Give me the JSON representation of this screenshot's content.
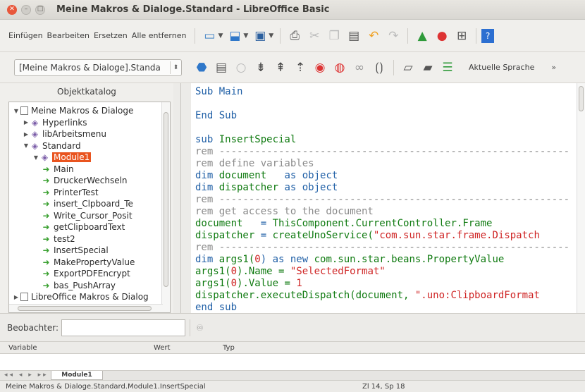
{
  "window": {
    "title": "Meine Makros & Dialoge.Standard - LibreOffice Basic"
  },
  "toolbar1": {
    "insert": "Einfügen",
    "edit": "Bearbeiten",
    "replace": "Ersetzen",
    "remove_all": "Alle entfernen"
  },
  "toolbar2": {
    "library_select": "[Meine Makros & Dialoge].Standa",
    "language": "Aktuelle Sprache",
    "overflow": "»"
  },
  "catalog": {
    "title": "Objektkatalog",
    "items": [
      {
        "label": "Meine Makros & Dialoge",
        "level": 0,
        "toggle": "▼",
        "icon": "document-icon"
      },
      {
        "label": "Hyperlinks",
        "level": 1,
        "toggle": "▶",
        "icon": "library-icon"
      },
      {
        "label": "libArbeitsmenu",
        "level": 1,
        "toggle": "▶",
        "icon": "library-icon"
      },
      {
        "label": "Standard",
        "level": 1,
        "toggle": "▼",
        "icon": "library-icon"
      },
      {
        "label": "Module1",
        "level": 2,
        "toggle": "▼",
        "icon": "module-icon",
        "selected": true
      },
      {
        "label": "Main",
        "level": 3,
        "icon": "macro-icon"
      },
      {
        "label": "DruckerWechseln",
        "level": 3,
        "icon": "macro-icon"
      },
      {
        "label": "PrinterTest",
        "level": 3,
        "icon": "macro-icon"
      },
      {
        "label": "insert_Clpboard_Te",
        "level": 3,
        "icon": "macro-icon"
      },
      {
        "label": "Write_Cursor_Posit",
        "level": 3,
        "icon": "macro-icon"
      },
      {
        "label": "getClipboardText",
        "level": 3,
        "icon": "macro-icon"
      },
      {
        "label": "test2",
        "level": 3,
        "icon": "macro-icon"
      },
      {
        "label": "InsertSpecial",
        "level": 3,
        "icon": "macro-icon"
      },
      {
        "label": "MakePropertyValue",
        "level": 3,
        "icon": "macro-icon"
      },
      {
        "label": "ExportPDFEncrypt",
        "level": 3,
        "icon": "macro-icon"
      },
      {
        "label": "bas_PushArray",
        "level": 3,
        "icon": "macro-icon"
      },
      {
        "label": "LibreOffice Makros & Dialog",
        "level": 0,
        "toggle": "▶",
        "icon": "document-icon"
      }
    ]
  },
  "code": {
    "lines": [
      [
        {
          "t": "Sub Main",
          "c": "kw"
        }
      ],
      [],
      [
        {
          "t": "End Sub",
          "c": "kw"
        }
      ],
      [],
      [
        {
          "t": "sub ",
          "c": "kw"
        },
        {
          "t": "InsertSpecial",
          "c": "id"
        }
      ],
      [
        {
          "t": "rem -----------------------------------------------------------",
          "c": "cm"
        }
      ],
      [
        {
          "t": "rem define variables",
          "c": "cm"
        }
      ],
      [
        {
          "t": "dim ",
          "c": "kw"
        },
        {
          "t": "document",
          "c": "id"
        },
        {
          "t": "   as object",
          "c": "kw"
        }
      ],
      [
        {
          "t": "dim ",
          "c": "kw"
        },
        {
          "t": "dispatcher",
          "c": "id"
        },
        {
          "t": " as object",
          "c": "kw"
        }
      ],
      [
        {
          "t": "rem -----------------------------------------------------------",
          "c": "cm"
        }
      ],
      [
        {
          "t": "rem get access to the document",
          "c": "cm"
        }
      ],
      [
        {
          "t": "document",
          "c": "id"
        },
        {
          "t": "   = ",
          "c": "kw"
        },
        {
          "t": "ThisComponent.CurrentController.Frame",
          "c": "id"
        }
      ],
      [
        {
          "t": "dispatcher",
          "c": "id"
        },
        {
          "t": " = ",
          "c": "kw"
        },
        {
          "t": "createUnoService(",
          "c": "id"
        },
        {
          "t": "\"com.sun.star.frame.Dispatch",
          "c": "st"
        }
      ],
      [
        {
          "t": "rem -----------------------------------------------------------",
          "c": "cm"
        }
      ],
      [
        {
          "t": "dim ",
          "c": "kw"
        },
        {
          "t": "args1(",
          "c": "id"
        },
        {
          "t": "0",
          "c": "nm"
        },
        {
          "t": ") as new ",
          "c": "kw"
        },
        {
          "t": "com.sun.star.beans.PropertyValue",
          "c": "id"
        }
      ],
      [
        {
          "t": "args1(",
          "c": "id"
        },
        {
          "t": "0",
          "c": "nm"
        },
        {
          "t": ").Name = ",
          "c": "id"
        },
        {
          "t": "\"SelectedFormat\"",
          "c": "st"
        }
      ],
      [
        {
          "t": "args1(",
          "c": "id"
        },
        {
          "t": "0",
          "c": "nm"
        },
        {
          "t": ").Value = ",
          "c": "id"
        },
        {
          "t": "1",
          "c": "nm"
        }
      ],
      [
        {
          "t": "dispatcher.executeDispatch(document, ",
          "c": "id"
        },
        {
          "t": "\".uno:ClipboardFormat",
          "c": "st"
        }
      ],
      [
        {
          "t": "end sub",
          "c": "kw"
        }
      ]
    ]
  },
  "watch": {
    "label": "Beobachter:",
    "col_variable": "Variable",
    "col_value": "Wert",
    "col_type": "Typ"
  },
  "tabs": {
    "module_tab": "Module1"
  },
  "status": {
    "path": "Meine Makros & Dialoge.Standard.Module1.InsertSpecial",
    "position": "Zl 14, Sp 18"
  },
  "colors": {
    "accent": "#e9541f",
    "keyword": "#1f5fa6",
    "identifier": "#0f7a10",
    "comment": "#8a8a8a",
    "string": "#cf2525"
  }
}
